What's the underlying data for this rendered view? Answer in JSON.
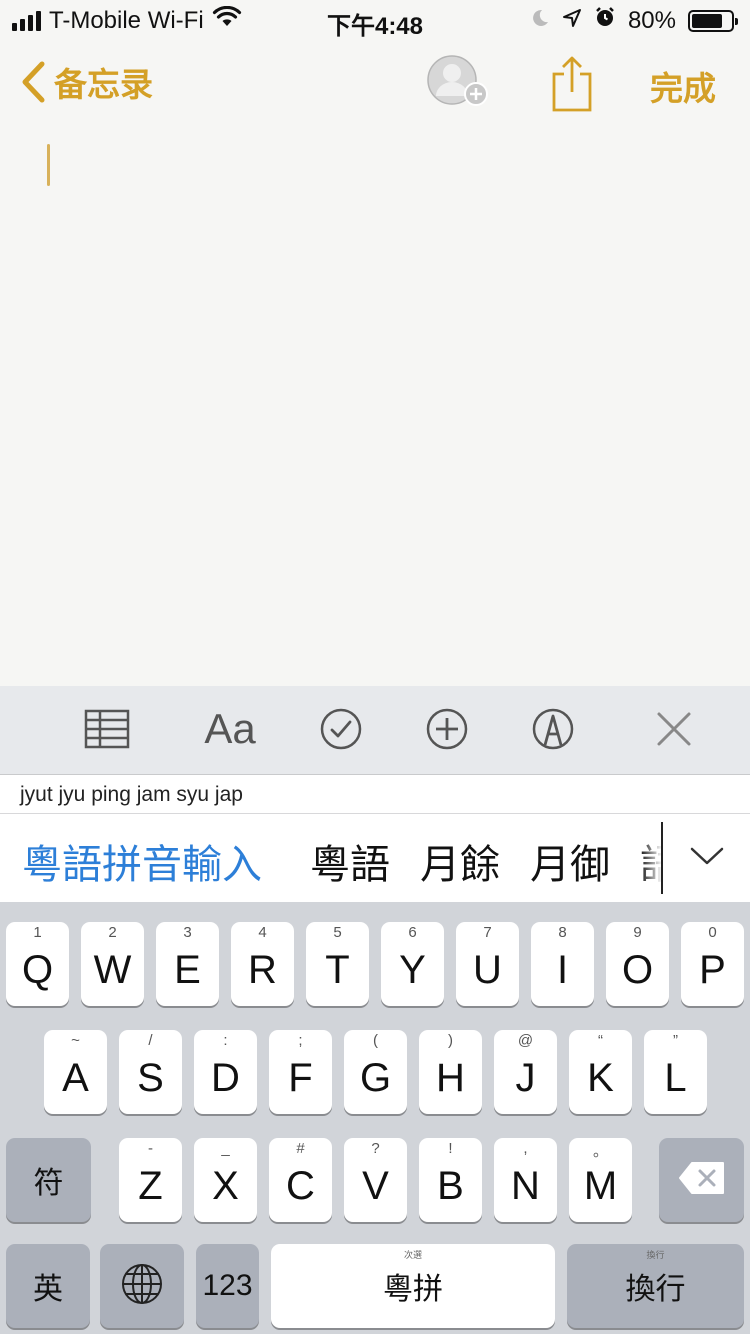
{
  "status_bar": {
    "carrier": "T-Mobile Wi-Fi",
    "time": "下午4:48",
    "battery": "80%",
    "battery_level": 0.8,
    "icons": [
      "signal-icon",
      "wifi-icon",
      "moon-icon",
      "location-icon",
      "alarm-icon",
      "battery-icon"
    ]
  },
  "nav": {
    "back_label": "备忘录",
    "done_label": "完成",
    "icons": [
      "chevron-left-icon",
      "add-person-icon",
      "share-icon"
    ]
  },
  "toolbar": {
    "format_label": "Aa",
    "icons": [
      "table-icon",
      "text-format-icon",
      "checklist-icon",
      "add-icon",
      "markup-icon",
      "close-icon"
    ]
  },
  "ime": {
    "composition": "jyut jyu ping jam syu jap",
    "candidates": [
      "粵語拼音輸入",
      "粵語",
      "月餘",
      "月御",
      "語"
    ]
  },
  "keyboard": {
    "row1": [
      {
        "key": "Q",
        "hint": "1"
      },
      {
        "key": "W",
        "hint": "2"
      },
      {
        "key": "E",
        "hint": "3"
      },
      {
        "key": "R",
        "hint": "4"
      },
      {
        "key": "T",
        "hint": "5"
      },
      {
        "key": "Y",
        "hint": "6"
      },
      {
        "key": "U",
        "hint": "7"
      },
      {
        "key": "I",
        "hint": "8"
      },
      {
        "key": "O",
        "hint": "9"
      },
      {
        "key": "P",
        "hint": "0"
      }
    ],
    "row2": [
      {
        "key": "A",
        "hint": "~"
      },
      {
        "key": "S",
        "hint": "/"
      },
      {
        "key": "D",
        "hint": ":"
      },
      {
        "key": "F",
        "hint": ";"
      },
      {
        "key": "G",
        "hint": "("
      },
      {
        "key": "H",
        "hint": ")"
      },
      {
        "key": "J",
        "hint": "@"
      },
      {
        "key": "K",
        "hint": "“"
      },
      {
        "key": "L",
        "hint": "”"
      }
    ],
    "row3": [
      {
        "key": "Z",
        "hint": "-"
      },
      {
        "key": "X",
        "hint": "_"
      },
      {
        "key": "C",
        "hint": "#"
      },
      {
        "key": "V",
        "hint": "?"
      },
      {
        "key": "B",
        "hint": "!"
      },
      {
        "key": "N",
        "hint": ","
      },
      {
        "key": "M",
        "hint": "。"
      }
    ],
    "symbol_key": "符",
    "english_key": "英",
    "numbers_key": "123",
    "space_label": "粵拼",
    "space_hint": "次選",
    "return_label": "換行",
    "return_hint": "換行"
  },
  "colors": {
    "accent": "#d4a027",
    "candidate_highlight": "#2d7fd8",
    "keyboard_bg": "#d1d4d9",
    "dark_key": "#abb0ba"
  }
}
